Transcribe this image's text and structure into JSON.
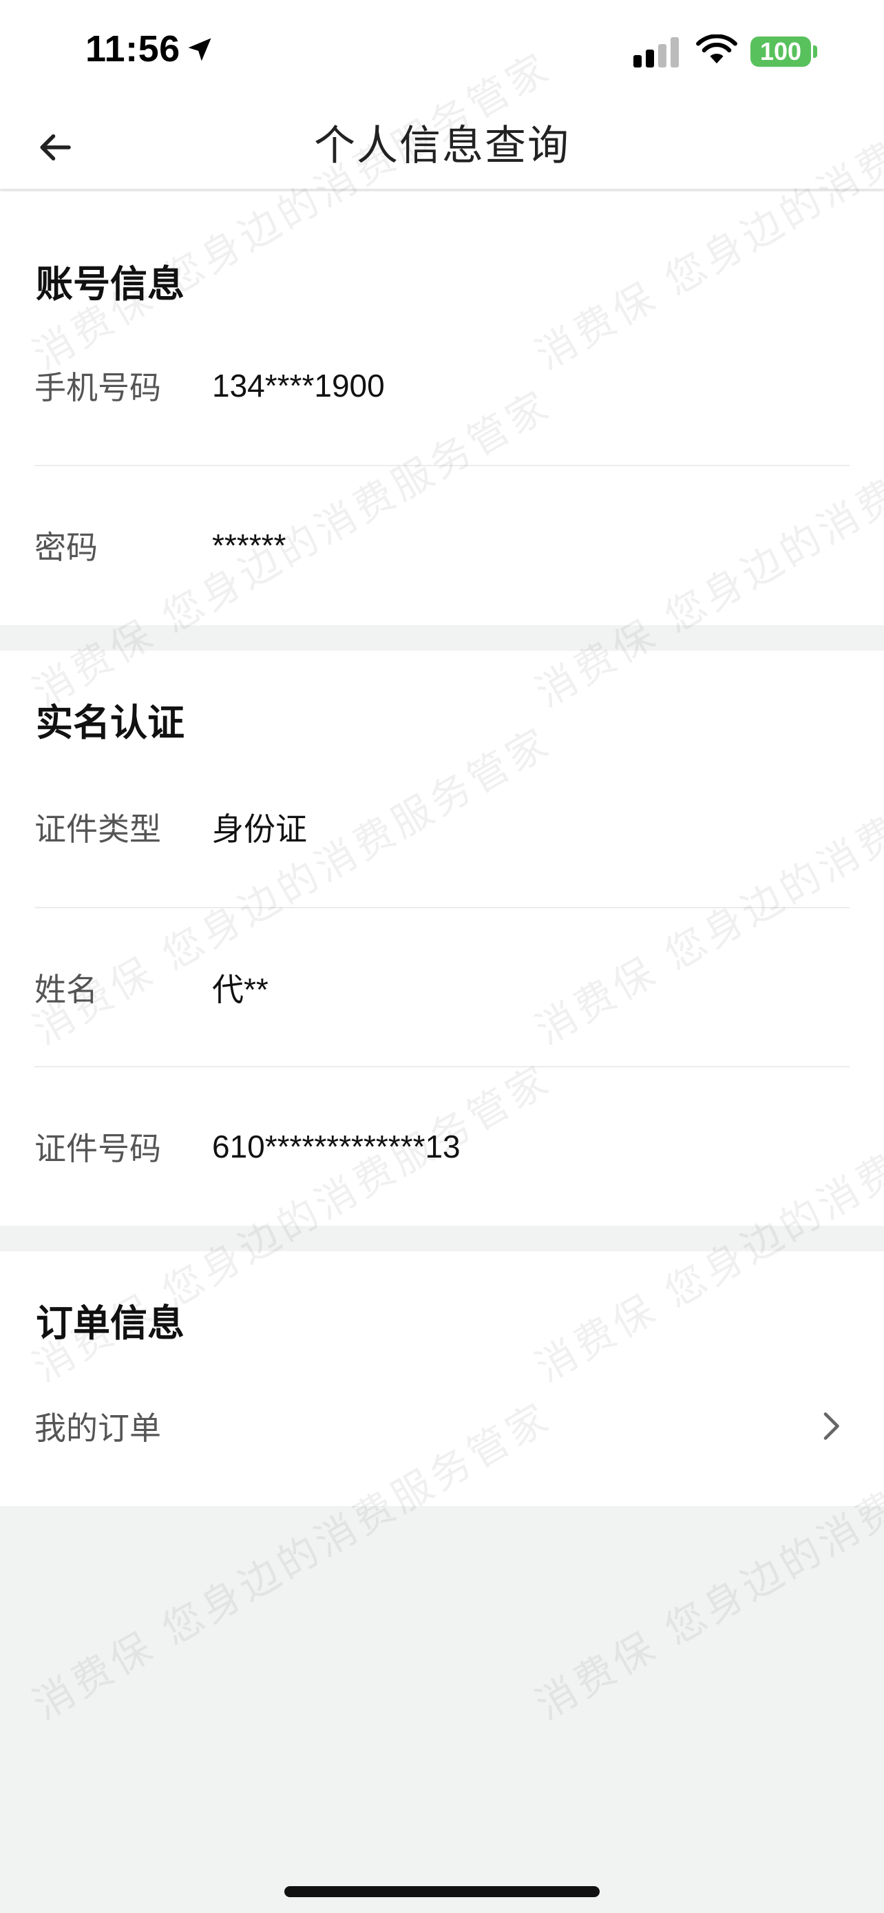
{
  "status_bar": {
    "time": "11:56",
    "battery": "100",
    "icons": [
      "location-arrow-icon",
      "cellular-signal-icon",
      "wifi-icon",
      "battery-icon"
    ],
    "battery_color": "#58c15c"
  },
  "nav": {
    "title": "个人信息查询",
    "back_icon": "arrow-left-icon"
  },
  "account": {
    "title": "账号信息",
    "rows": [
      {
        "label": "手机号码",
        "value": "134****1900"
      },
      {
        "label": "密码",
        "value": "******"
      }
    ]
  },
  "realname": {
    "title": "实名认证",
    "rows": [
      {
        "label": "证件类型",
        "value": "身份证"
      },
      {
        "label": "姓名",
        "value": "代**"
      },
      {
        "label": "证件号码",
        "value": "610*************13"
      }
    ]
  },
  "orders": {
    "title": "订单信息",
    "rows": [
      {
        "label": "我的订单",
        "icon": "chevron-right-icon"
      }
    ]
  },
  "watermark": {
    "text": "消费保 您身边的消费服务管家"
  },
  "colors": {
    "page_background": "#f1f2f2",
    "card_background": "#ffffff",
    "label_text": "#555555",
    "value_text": "#111111"
  }
}
